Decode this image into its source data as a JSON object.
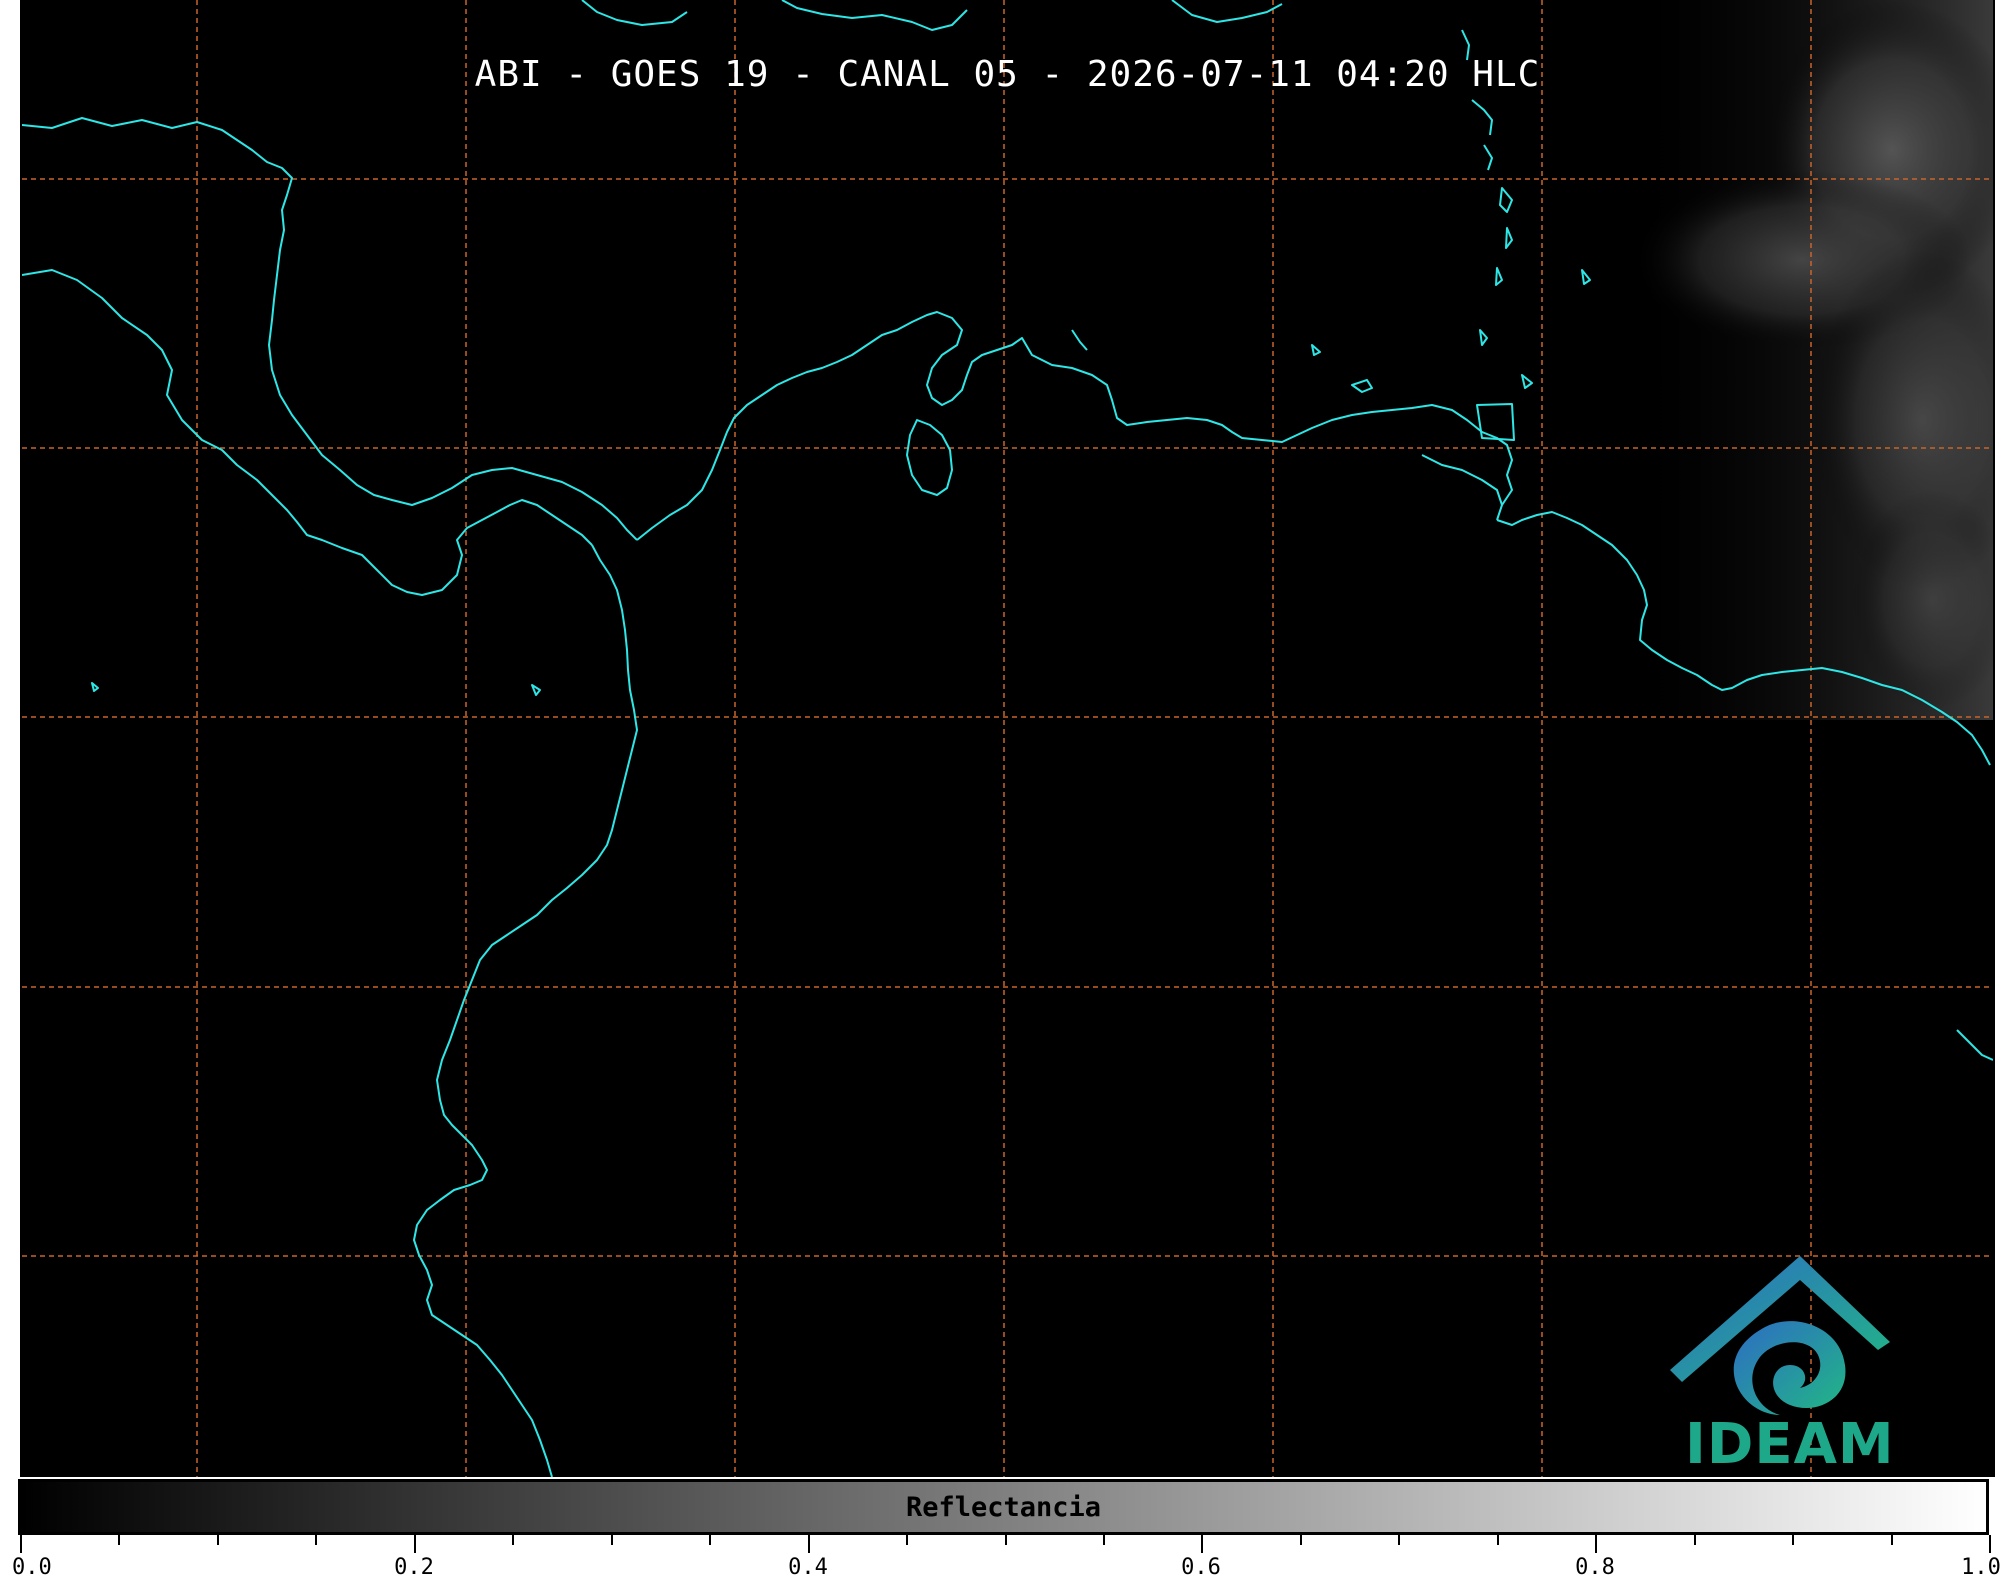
{
  "title": "ABI - GOES 19 - CANAL 05 - 2026-07-11 04:20 HLC",
  "colorbar": {
    "label": "Reflectancia",
    "min": 0.0,
    "max": 1.0,
    "tick_labels": [
      "0.0",
      "0.2",
      "0.4",
      "0.6",
      "0.8",
      "1.0"
    ],
    "colormap": [
      "#000000",
      "#ffffff"
    ]
  },
  "logo": {
    "text": "IDEAM",
    "color": "#1ea88a"
  },
  "map": {
    "background": "#000000",
    "coastline_color": "#2ee6e6",
    "graticule_color": "#c8642a",
    "graticule_style": "dashed"
  }
}
